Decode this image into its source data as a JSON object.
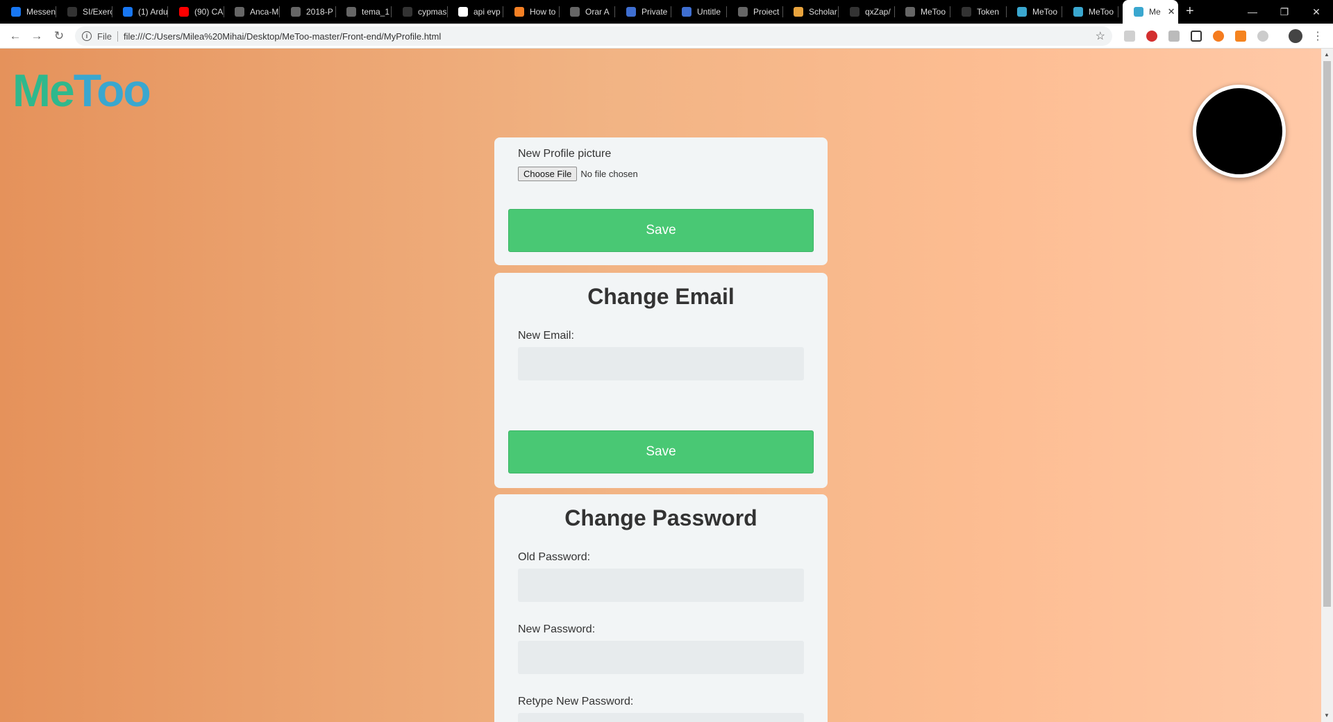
{
  "browser": {
    "tabs": [
      {
        "label": "Messen",
        "fav_color": "#1877f2"
      },
      {
        "label": "SI/Exerc",
        "fav_color": "#333333"
      },
      {
        "label": "(1) Ardu",
        "fav_color": "#1877f2"
      },
      {
        "label": "(90) CA",
        "fav_color": "#ff0000"
      },
      {
        "label": "Anca-M",
        "fav_color": "#666666"
      },
      {
        "label": "2018-P",
        "fav_color": "#666666"
      },
      {
        "label": "tema_1",
        "fav_color": "#666666"
      },
      {
        "label": "cypmas",
        "fav_color": "#333333"
      },
      {
        "label": "api evp",
        "fav_color": "#ffffff"
      },
      {
        "label": "How to",
        "fav_color": "#f48024"
      },
      {
        "label": "Orar A",
        "fav_color": "#666666"
      },
      {
        "label": "Private",
        "fav_color": "#3f6fd1"
      },
      {
        "label": "Untitle",
        "fav_color": "#3f6fd1"
      },
      {
        "label": "Proiect",
        "fav_color": "#666666"
      },
      {
        "label": "Scholar",
        "fav_color": "#e8a33d"
      },
      {
        "label": "qxZap/",
        "fav_color": "#333333"
      },
      {
        "label": "MeToo",
        "fav_color": "#666666"
      },
      {
        "label": "Token",
        "fav_color": "#333333"
      },
      {
        "label": "MeToo",
        "fav_color": "#3aa7cf"
      },
      {
        "label": "MeToo",
        "fav_color": "#3aa7cf"
      }
    ],
    "active_tab": {
      "label": "Me",
      "fav_color": "#3aa7cf"
    },
    "new_tab_icon": "+",
    "url_scheme": "File",
    "url": "file:///C:/Users/Milea%20Mihai/Desktop/MeToo-master/Front-end/MyProfile.html"
  },
  "page": {
    "logo": {
      "part1": "Me",
      "part2": "Too"
    },
    "picture_card": {
      "label": "New Profile picture",
      "file_button": "Choose File",
      "file_status": "No file chosen",
      "save": "Save"
    },
    "email_card": {
      "title": "Change Email",
      "new_email_label": "New Email:",
      "new_email_value": "",
      "save": "Save"
    },
    "password_card": {
      "title": "Change Password",
      "old_label": "Old Password:",
      "new_label": "New Password:",
      "retype_label": "Retype New Password:"
    }
  }
}
